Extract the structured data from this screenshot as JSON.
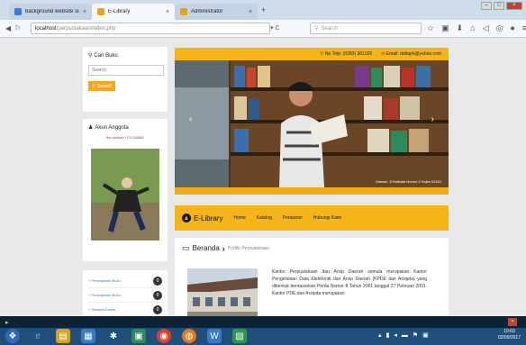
{
  "browser": {
    "tabs": [
      {
        "label": "background website simpl...",
        "favicon_color": "#3b7bd8"
      },
      {
        "label": "E-Library",
        "favicon_color": "#e8a317"
      },
      {
        "label": "Administrator",
        "favicon_color": "#e8a317"
      }
    ],
    "url_host": "localhost",
    "url_path": "/perpustakaan/index.php",
    "search_placeholder": "Search"
  },
  "sidebar": {
    "search_title": "Cari Buku",
    "search_placeholder": "Search",
    "search_button": "Search",
    "account_title": "Akun Anggota",
    "account_user": "Ika Arishah / PG248881",
    "menu": [
      {
        "label": "» Peminjaman Buku",
        "count": "0"
      },
      {
        "label": "» Peminjaman Buku",
        "count": "0"
      },
      {
        "label": "» Riwayat Denda",
        "count": "0"
      }
    ]
  },
  "header": {
    "phone": "No.Telp: (0283) 381026",
    "email": "Email: daftapk@yahoo.com"
  },
  "hero": {
    "address": "Alamat: Jl Kalibata Nomor 2 Kajen 51161"
  },
  "nav": {
    "brand": "E-Library",
    "links": [
      "Home",
      "Katalog",
      "Peraturan",
      "Hubungi Kami"
    ]
  },
  "content": {
    "title": "Beranda",
    "subtitle": "Profile Perpustakaan",
    "paragraph": "Kantor Perpustakaan dan Arsip Daerah semula merupakan Kantor Pengelolaan Data Elektronik dan Arsip Daerah (KPDE dan Arsipda) yang dibentuk berdasarkan Perda Nomor 8 Tahun 2001 tanggal 27 Pebruari 2001. Kantor PDE dan Arsipda merupakan"
  },
  "taskbar": {
    "time": "10:03",
    "date": "02/09/2017"
  },
  "colors": {
    "accent": "#f5b418",
    "button": "#f5a623",
    "taskbar": "#1f4f7a"
  }
}
